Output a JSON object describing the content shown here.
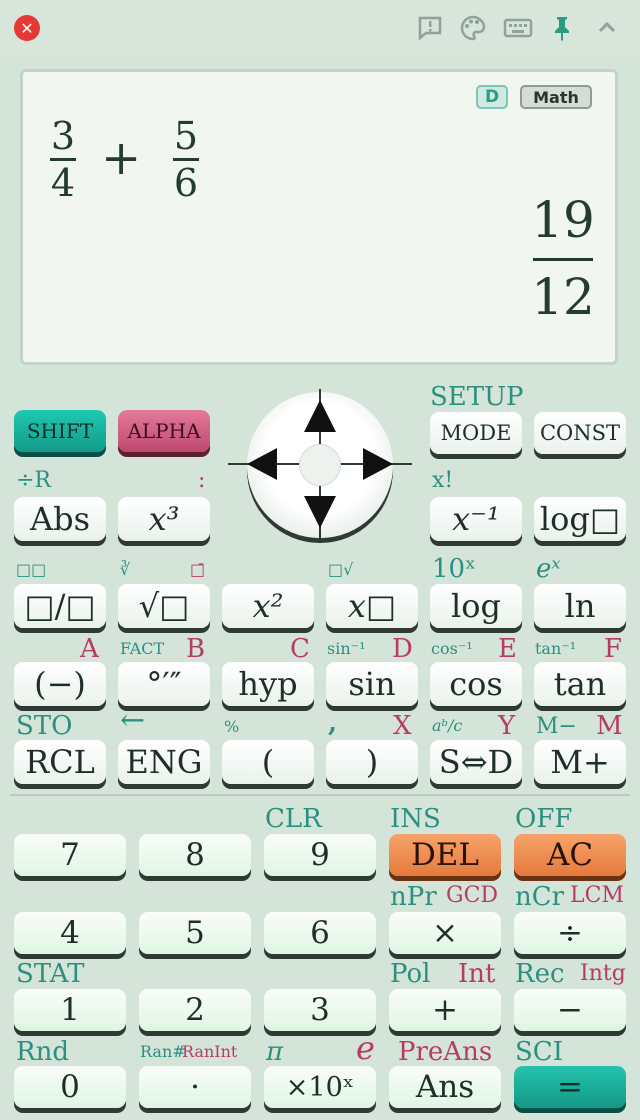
{
  "toolbar": {
    "close_icon": "close-icon",
    "icons": [
      "feedback-icon",
      "palette-icon",
      "keyboard-icon",
      "pin-icon",
      "chevron-up-icon"
    ]
  },
  "display": {
    "angle_mode": "D",
    "input_mode": "Math",
    "expression": {
      "f1_num": "3",
      "f1_den": "4",
      "operator": "+",
      "f2_num": "5",
      "f2_den": "6"
    },
    "result": {
      "num": "19",
      "den": "12"
    }
  },
  "function_keys": {
    "shift": "SHIFT",
    "alpha": "ALPHA",
    "mode": "MODE",
    "const": "CONST",
    "abs": "Abs",
    "x3": "x³",
    "xinv": "x⁻¹",
    "logbox": "log□",
    "frac": "□/□",
    "sqrt": "√□",
    "x2": "x²",
    "xpow": "x□",
    "log": "log",
    "ln": "ln",
    "neg": "(−)",
    "dms": "°′″",
    "hyp": "hyp",
    "sin": "sin",
    "cos": "cos",
    "tan": "tan",
    "rcl": "RCL",
    "eng": "ENG",
    "lparen": "(",
    "rparen": ")",
    "sd": "S⇔D",
    "mplus": "M+"
  },
  "shift_labels": {
    "setup": "SETUP",
    "divr": "÷R",
    "colon": ":",
    "fact_x": "x!",
    "mixed": "□□",
    "cbrt": "∛",
    "bar": "□̄",
    "nroot": "□√",
    "ten_x": "10ˣ",
    "e_x": "eˣ",
    "a": "A",
    "fact": "FACT",
    "b": "B",
    "c": "C",
    "asin": "sin⁻¹",
    "d": "D",
    "acos": "cos⁻¹",
    "e": "E",
    "atan": "tan⁻¹",
    "f": "F",
    "sto": "STO",
    "left": "←",
    "pct": "%",
    "comma": ",",
    "x": "X",
    "abc": "aᵇ/c",
    "y": "Y",
    "mminus": "M−",
    "m": "M",
    "clr": "CLR",
    "ins": "INS",
    "off": "OFF",
    "npr": "nPr",
    "gcd": "GCD",
    "ncr": "nCr",
    "lcm": "LCM",
    "stat": "STAT",
    "pol": "Pol",
    "int": "Int",
    "rec": "Rec",
    "intg": "Intg",
    "rnd": "Rnd",
    "ran": "Ran#",
    "ranint": "RanInt",
    "pi": "π",
    "econst": "e",
    "preans": "PreAns",
    "sci": "SCI"
  },
  "number_keys": {
    "k7": "7",
    "k8": "8",
    "k9": "9",
    "del": "DEL",
    "ac": "AC",
    "k4": "4",
    "k5": "5",
    "k6": "6",
    "mul": "×",
    "div": "÷",
    "k1": "1",
    "k2": "2",
    "k3": "3",
    "add": "+",
    "sub": "−",
    "k0": "0",
    "dot": "·",
    "exp": "×10ˣ",
    "ans": "Ans",
    "eq": "="
  },
  "colors": {
    "shift": "#1bb5a0",
    "alpha": "#d2668a",
    "orange": "#ee8a4c",
    "teal_label": "#2a9080",
    "pink_label": "#b63c68"
  }
}
